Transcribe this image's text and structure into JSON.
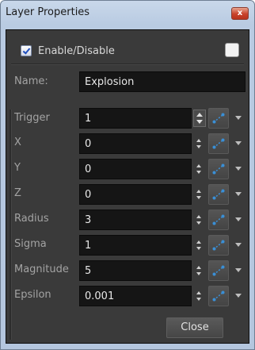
{
  "window": {
    "title": "Layer Properties",
    "close_glyph": "x"
  },
  "enable": {
    "label": "Enable/Disable",
    "checked": true
  },
  "name": {
    "label": "Name:",
    "value": "Explosion"
  },
  "params": [
    {
      "label": "Trigger",
      "value": "1"
    },
    {
      "label": "X",
      "value": "0"
    },
    {
      "label": "Y",
      "value": "0"
    },
    {
      "label": "Z",
      "value": "0"
    },
    {
      "label": "Radius",
      "value": "3"
    },
    {
      "label": "Sigma",
      "value": "1"
    },
    {
      "label": "Magnitude",
      "value": "5"
    },
    {
      "label": "Epsilon",
      "value": "0.001"
    }
  ],
  "icons": {
    "function": "function-curve-icon",
    "menu": "chevron-down-icon",
    "spinner": "spinner-arrows-icon"
  },
  "buttons": {
    "close": "Close"
  },
  "colors": {
    "panel_bg": "#3a3a3a",
    "field_bg": "#151515",
    "accent": "#3a8fd6"
  }
}
